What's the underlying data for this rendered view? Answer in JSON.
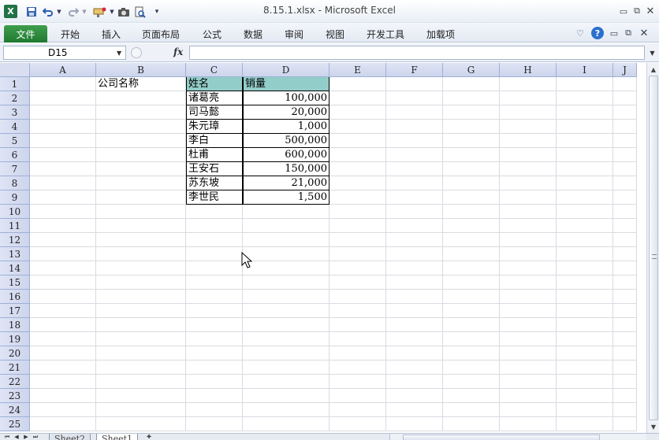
{
  "window": {
    "title": "8.15.1.xlsx  -  Microsoft Excel",
    "app_icon": "X"
  },
  "ribbon": {
    "tabs": [
      "文件",
      "开始",
      "插入",
      "页面布局",
      "公式",
      "数据",
      "审阅",
      "视图",
      "开发工具",
      "加载项"
    ]
  },
  "formula_bar": {
    "name_box": "D15",
    "fx": "fx",
    "value": ""
  },
  "grid": {
    "columns": [
      "A",
      "B",
      "C",
      "D",
      "E",
      "F",
      "G",
      "H",
      "I",
      "J"
    ],
    "rows": [
      "1",
      "2",
      "3",
      "4",
      "5",
      "6",
      "7",
      "8",
      "9",
      "10",
      "11",
      "12",
      "13",
      "14",
      "15",
      "16",
      "17",
      "18",
      "19",
      "20",
      "21",
      "22",
      "23",
      "24",
      "25"
    ],
    "b1": "公司名称",
    "table_header": {
      "name": "姓名",
      "sales": "销量"
    },
    "table_rows": [
      {
        "name": "诸葛亮",
        "sales": "100,000"
      },
      {
        "name": "司马懿",
        "sales": "20,000"
      },
      {
        "name": "朱元璋",
        "sales": "1,000"
      },
      {
        "name": "李白",
        "sales": "500,000"
      },
      {
        "name": "杜甫",
        "sales": "600,000"
      },
      {
        "name": "王安石",
        "sales": "150,000"
      },
      {
        "name": "苏东坡",
        "sales": "21,000"
      },
      {
        "name": "李世民",
        "sales": "1,500"
      }
    ],
    "header_fill": "#92cdc9"
  },
  "sheets": {
    "tabs": [
      "Sheet2",
      "Sheet1"
    ]
  }
}
